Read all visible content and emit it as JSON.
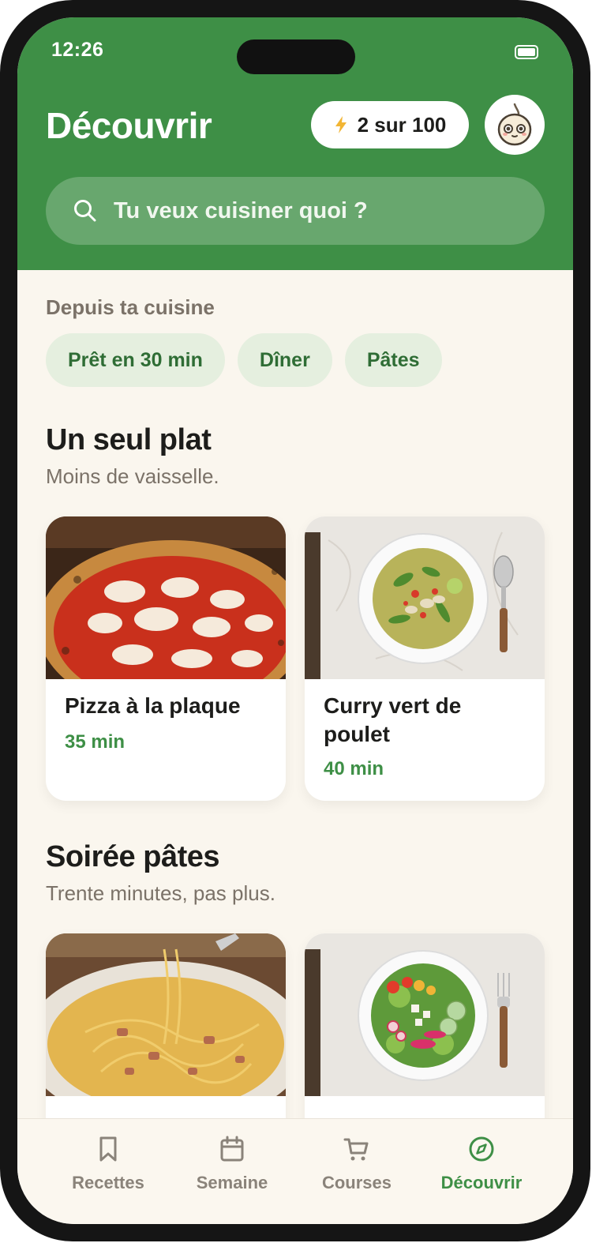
{
  "status_bar": {
    "time": "12:26"
  },
  "header": {
    "title": "Découvrir",
    "credits_label": "2 sur 100",
    "avatar_icon": "onion-mascot-icon",
    "search_placeholder": "Tu veux cuisiner quoi ?"
  },
  "colors": {
    "brand_green": "#3e8f46",
    "background": "#faf6ee",
    "chip_bg": "#e5efdf",
    "accent_bolt": "#f2b534"
  },
  "kitchen": {
    "label": "Depuis ta cuisine",
    "chips": [
      "Prêt en 30 min",
      "Dîner",
      "Pâtes"
    ]
  },
  "sections": [
    {
      "title": "Un seul plat",
      "subtitle": "Moins de vaisselle.",
      "cards": [
        {
          "title": "Pizza à la plaque",
          "time": "35 min",
          "image": "pizza"
        },
        {
          "title": "Curry vert de poulet",
          "time": "40 min",
          "image": "green-curry"
        }
      ]
    },
    {
      "title": "Soirée pâtes",
      "subtitle": "Trente minutes, pas plus.",
      "cards": [
        {
          "title": "",
          "time": "",
          "image": "carbonara"
        },
        {
          "title": "",
          "time": "",
          "image": "salad"
        }
      ]
    }
  ],
  "tabbar": {
    "active": "Découvrir",
    "items": [
      {
        "label": "Recettes",
        "icon": "bookmark-icon"
      },
      {
        "label": "Semaine",
        "icon": "calendar-icon"
      },
      {
        "label": "Courses",
        "icon": "cart-icon"
      },
      {
        "label": "Découvrir",
        "icon": "compass-icon"
      }
    ]
  }
}
